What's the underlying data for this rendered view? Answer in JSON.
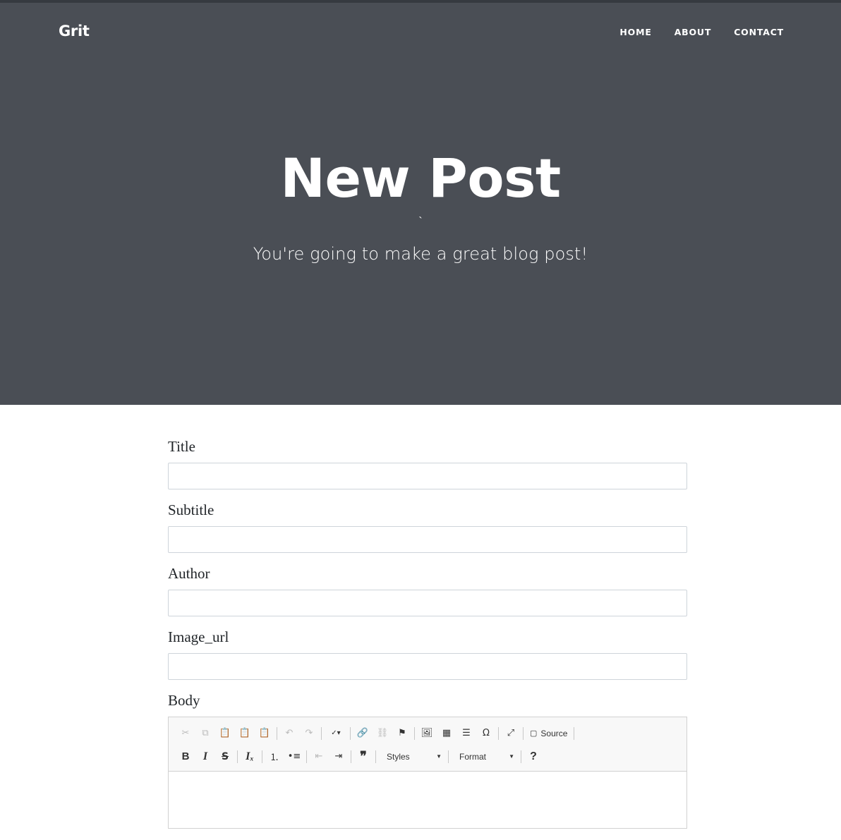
{
  "brand": "Grit",
  "nav": [
    "HOME",
    "ABOUT",
    "CONTACT"
  ],
  "hero": {
    "title": "New Post",
    "tick": "`",
    "subtitle": "You're going to make a great blog post!"
  },
  "form": {
    "fields": [
      {
        "label": "Title",
        "value": ""
      },
      {
        "label": "Subtitle",
        "value": ""
      },
      {
        "label": "Author",
        "value": ""
      },
      {
        "label": "Image_url",
        "value": ""
      }
    ],
    "body_label": "Body"
  },
  "editor": {
    "source_label": "Source",
    "styles_label": "Styles",
    "format_label": "Format",
    "help_label": "?"
  }
}
